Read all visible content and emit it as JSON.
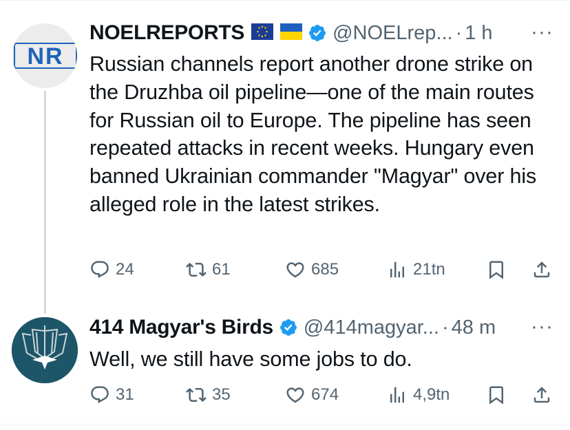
{
  "posts": [
    {
      "author": "NOELREPORTS",
      "flags": [
        "eu-flag-icon",
        "ukraine-flag-icon"
      ],
      "handle": "@NOELrep...",
      "separator": "·",
      "time": "1 h",
      "more": "···",
      "avatar": {
        "initials": "NR"
      },
      "text": "Russian channels report another drone strike on the Druzhba oil pipeline—one of the main routes for Russian oil to Europe. The pipeline has seen repeated attacks in recent weeks. Hungary even banned Ukrainian commander \"Magyar\" over his alleged role in the latest strikes.",
      "stats": {
        "replies": "24",
        "reposts": "61",
        "likes": "685",
        "views": "21tn"
      }
    },
    {
      "author": "414 Magyar's Birds",
      "handle": "@414magyar...",
      "separator": "·",
      "time": "48 m",
      "more": "···",
      "text": "Well, we still have some jobs to do.",
      "stats": {
        "replies": "31",
        "reposts": "35",
        "likes": "674",
        "views": "4,9tn"
      }
    }
  ],
  "colors": {
    "verified": "#1d9bf0",
    "secondary_text": "#536471",
    "nr_blue": "#1d63b8",
    "birds_bg": "#1d5569"
  }
}
